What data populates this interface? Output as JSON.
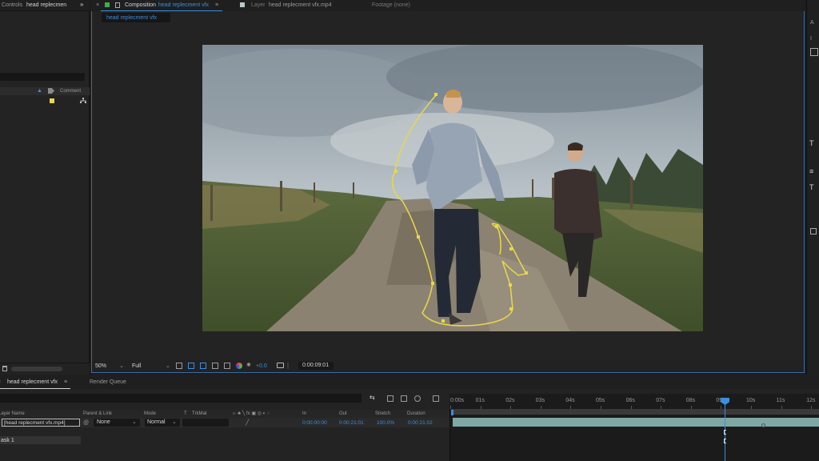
{
  "left_panel": {
    "tab_label": "Controls",
    "tab_name": "head replecmen",
    "comment_header": "Comment"
  },
  "composition": {
    "tab_prefix": "Composition",
    "tab_name": "head replecment vfx",
    "layer_tab_prefix": "Layer",
    "layer_tab_name": "head replecment vfx.mp4",
    "footage_tab": "Footage (none)",
    "sub_tab": "head replecment vfx"
  },
  "viewer_toolbar": {
    "zoom": "50%",
    "resolution": "Full",
    "exposure": "+0.0",
    "timecode": "0:00:09:01"
  },
  "timeline": {
    "tab_name": "head replecment vfx",
    "render_queue": "Render Queue",
    "columns": {
      "layer_name": "Layer Name",
      "parent": "Parent & Link",
      "mode": "Mode",
      "t": "T",
      "trkmat": "TrkMat",
      "in": "In",
      "out": "Out",
      "stretch": "Stretch",
      "duration": "Duration"
    },
    "layer": {
      "name": "[head replecment vfx.mp4]",
      "parent": "None",
      "mode": "Normal",
      "in": "0:00:00:00",
      "out": "0:00:21:01",
      "stretch": "100.0%",
      "duration": "0:00:21:02"
    },
    "mask_label": "ask 1",
    "ruler_ticks": [
      "0:00s",
      "01s",
      "02s",
      "03s",
      "04s",
      "05s",
      "06s",
      "07s",
      "08s",
      "09s",
      "10s",
      "11s",
      "12s"
    ]
  },
  "colors": {
    "accent": "#3a8fe0",
    "layer_bar": "#7fa8a4",
    "mask_path": "#e8d84a"
  }
}
